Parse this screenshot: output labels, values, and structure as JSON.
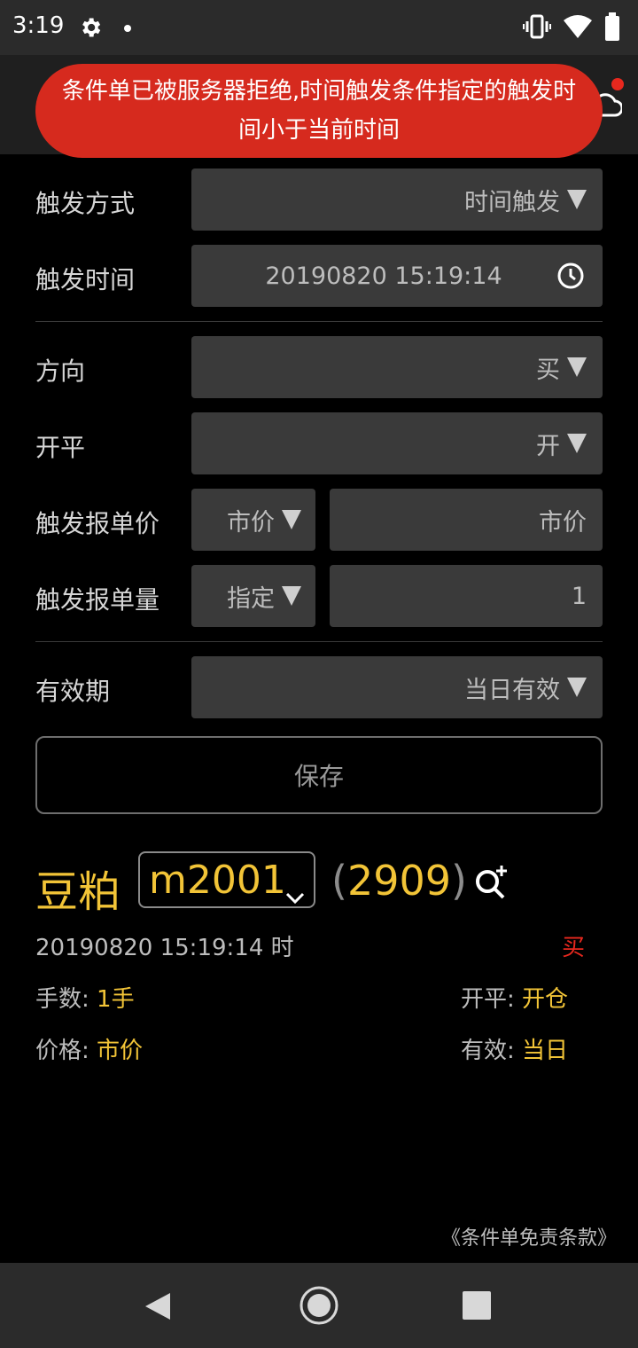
{
  "status_bar": {
    "time": "3:19",
    "icons": [
      "settings-gear-icon",
      "notification-dot-icon",
      "vibrate-icon",
      "wifi-icon",
      "battery-icon"
    ]
  },
  "toast": {
    "message": "条件单已被服务器拒绝,时间触发条件指定的触发时间小于当前时间",
    "color": "#d62a1e"
  },
  "form": {
    "trigger_mode": {
      "label": "触发方式",
      "value": "时间触发"
    },
    "trigger_time": {
      "label": "触发时间",
      "value": "20190820 15:19:14",
      "icon": "clock-icon"
    },
    "direction": {
      "label": "方向",
      "value": "买"
    },
    "open_close": {
      "label": "开平",
      "value": "开"
    },
    "trigger_price": {
      "label": "触发报单价",
      "type": "市价",
      "value": "市价"
    },
    "trigger_qty": {
      "label": "触发报单量",
      "type": "指定",
      "value": "1"
    },
    "validity": {
      "label": "有效期",
      "value": "当日有效"
    },
    "save_label": "保存"
  },
  "summary": {
    "product_name": "豆粕",
    "contract": "m2001",
    "price_open": "(",
    "price": "2909",
    "price_close": ")",
    "trigger_time_text": "20190820 15:19:14  时",
    "direction_text": "买",
    "qty_label": "手数:",
    "qty_value": "1手",
    "price_label": "价格:",
    "price_value": "市价",
    "open_close_label": "开平:",
    "open_close_value": "开仓",
    "validity_label": "有效:",
    "validity_value": "当日"
  },
  "footer": {
    "terms": "《条件单免责条款》"
  },
  "colors": {
    "accent_yellow": "#f2c437",
    "buy_red": "#e8281e",
    "field_bg": "#3a3a3a"
  }
}
